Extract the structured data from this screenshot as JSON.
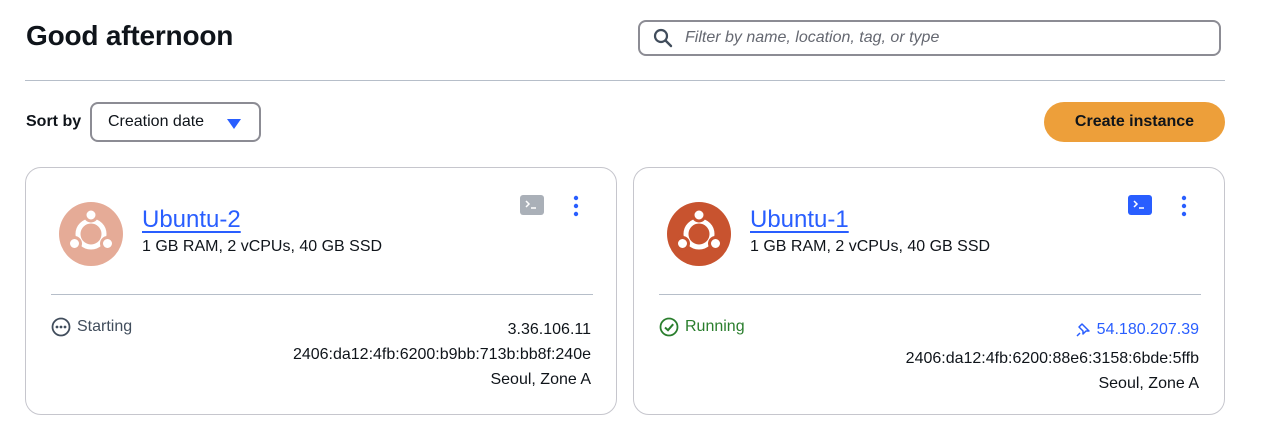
{
  "header": {
    "greeting": "Good afternoon",
    "search_placeholder": "Filter by name, location, tag, or type",
    "search_icon": "search-icon"
  },
  "toolbar": {
    "sort_label": "Sort by",
    "sort_value": "Creation date",
    "create_label": "Create instance"
  },
  "colors": {
    "accent_orange": "#ed9f3a",
    "link_blue": "#295eff",
    "ubuntu_orange": "#c8532f",
    "ubuntu_faded": "#e5ab97",
    "running_green": "#2a7e2d"
  },
  "instances": [
    {
      "name": "Ubuntu-2",
      "spec": "1 GB RAM, 2 vCPUs, 40 GB SSD",
      "status": "Starting",
      "ipv4": "3.36.106.11",
      "ipv6": "2406:da12:4fb:6200:b9bb:713b:bb8f:240e",
      "zone": "Seoul, Zone A"
    },
    {
      "name": "Ubuntu-1",
      "spec": "1 GB RAM, 2 vCPUs, 40 GB SSD",
      "status": "Running",
      "ipv4": "54.180.207.39",
      "ipv6": "2406:da12:4fb:6200:88e6:3158:6bde:5ffb",
      "zone": "Seoul, Zone A"
    }
  ]
}
